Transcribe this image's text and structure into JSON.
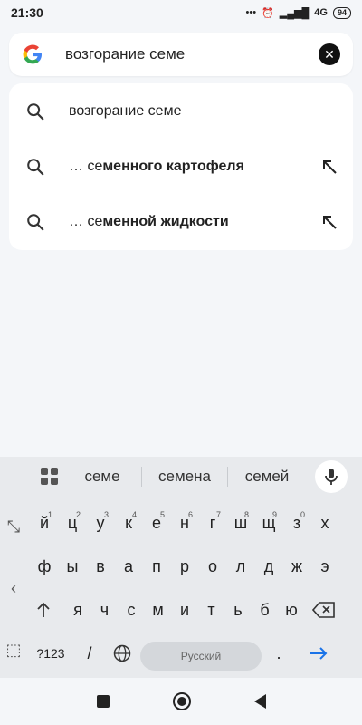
{
  "status": {
    "time": "21:30",
    "network": "4G",
    "battery": "94"
  },
  "search": {
    "query": "возгорание семе",
    "logo": "G"
  },
  "suggestions": [
    {
      "prefix": "",
      "bold": "",
      "text": "возгорание семе",
      "has_arrow": false
    },
    {
      "prefix": "… се",
      "bold": "менного картофеля",
      "has_arrow": true
    },
    {
      "prefix": "… се",
      "bold": "менной жидкости",
      "has_arrow": true
    }
  ],
  "keyboard": {
    "suggestions": [
      "семе",
      "семена",
      "семей"
    ],
    "row1": [
      [
        "й",
        "1"
      ],
      [
        "ц",
        "2"
      ],
      [
        "у",
        "3"
      ],
      [
        "к",
        "4"
      ],
      [
        "е",
        "5"
      ],
      [
        "н",
        "6"
      ],
      [
        "г",
        "7"
      ],
      [
        "ш",
        "8"
      ],
      [
        "щ",
        "9"
      ],
      [
        "з",
        "0"
      ],
      [
        "х",
        ""
      ]
    ],
    "row2": [
      "ф",
      "ы",
      "в",
      "а",
      "п",
      "р",
      "о",
      "л",
      "д",
      "ж",
      "э"
    ],
    "row3": [
      "я",
      "ч",
      "с",
      "м",
      "и",
      "т",
      "ь",
      "б",
      "ю"
    ],
    "symbols_label": "?123",
    "slash": "/",
    "space_label": "Русский",
    "period": "."
  },
  "colors": {
    "accent": "#1a73e8",
    "g_blue": "#4285f4",
    "g_red": "#ea4335",
    "g_yellow": "#fbbc05",
    "g_green": "#34a853"
  }
}
